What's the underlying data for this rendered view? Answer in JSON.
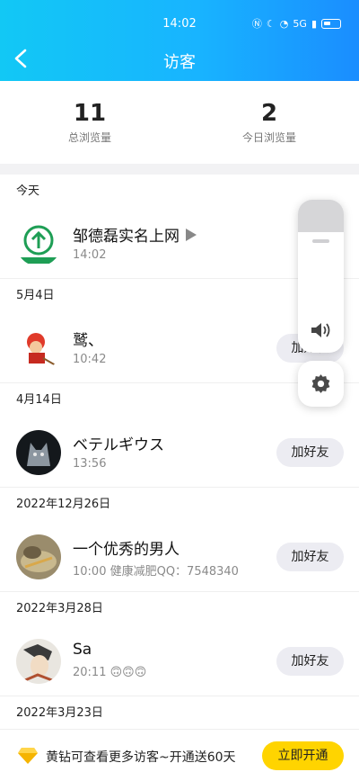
{
  "status_bar": {
    "time": "14:02",
    "network": "5G"
  },
  "header": {
    "title": "访客"
  },
  "stats": [
    {
      "value": "11",
      "label": "总浏览量"
    },
    {
      "value": "2",
      "label": "今日浏览量"
    }
  ],
  "groups": [
    {
      "date": "今天",
      "visitors": [
        {
          "name": "邹德磊实名上网",
          "time": "14:02",
          "button": ""
        }
      ]
    },
    {
      "date": "5月4日",
      "visitors": [
        {
          "name": "鹫、",
          "time": "10:42",
          "button": "加好友"
        }
      ]
    },
    {
      "date": "4月14日",
      "visitors": [
        {
          "name": "ベテルギウス",
          "time": "13:56",
          "button": "加好友"
        }
      ]
    },
    {
      "date": "2022年12月26日",
      "visitors": [
        {
          "name": "一个优秀的男人",
          "time": "10:00 健康减肥QQ：7548340",
          "button": "加好友"
        }
      ]
    },
    {
      "date": "2022年3月28日",
      "visitors": [
        {
          "name": "Sa",
          "time": "20:11 🙃🙃🙃",
          "button": "加好友"
        }
      ]
    },
    {
      "date": "2022年3月23日",
      "visitors": []
    }
  ],
  "bottom": {
    "promo": "黄钻可查看更多访客~开通送60天",
    "button": "立即开通"
  },
  "colors": {
    "header_start": "#12c8f5",
    "header_end": "#1a8dff",
    "open_button": "#ffd400"
  }
}
